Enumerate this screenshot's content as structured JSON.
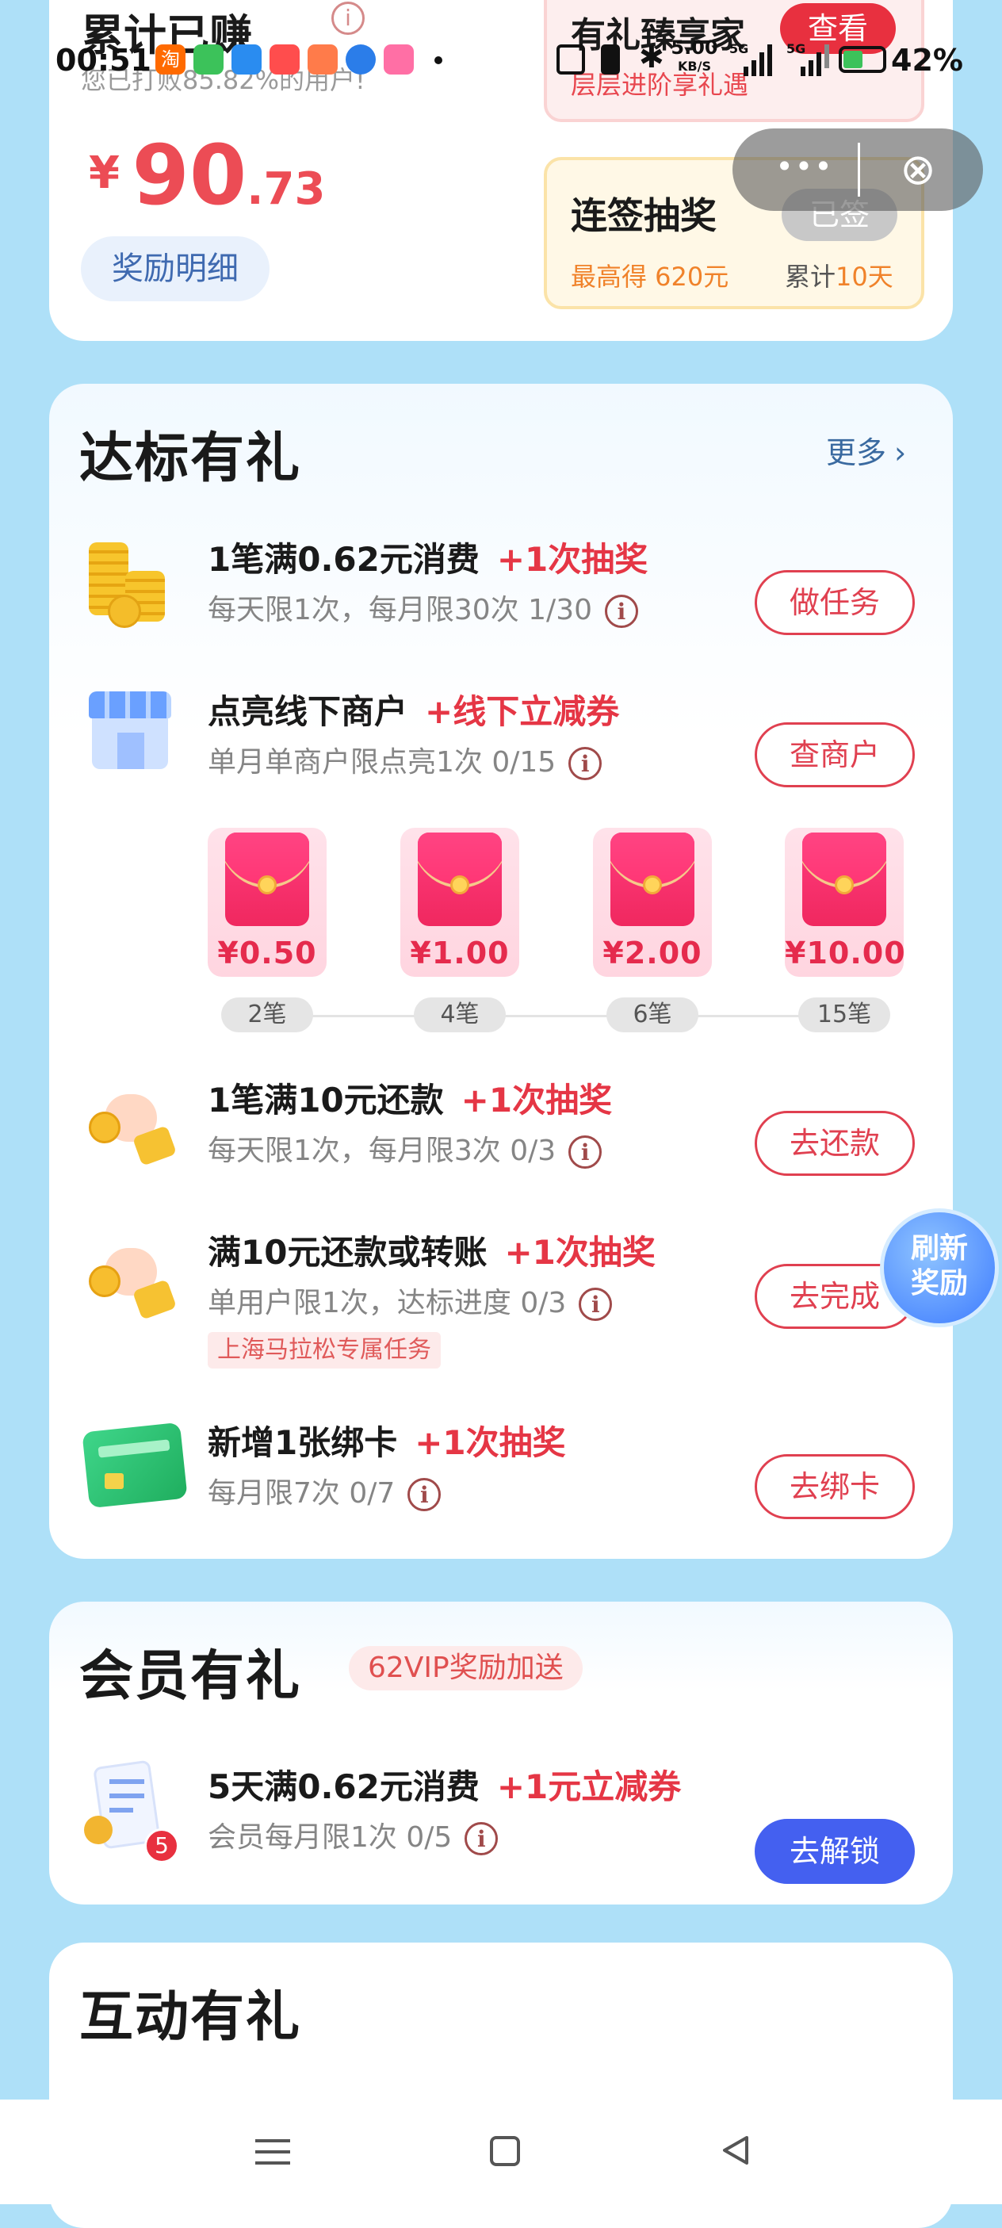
{
  "status_bar": {
    "time": "00:51",
    "app_icons": [
      "taobao-icon",
      "wechat-icon",
      "qq-icon",
      "app-icon",
      "mail-icon",
      "browser-icon",
      "bilibili-icon"
    ],
    "net_speed_top": "5.00",
    "net_speed_unit": "KB/S",
    "sig1": "5G",
    "sig2": "5G",
    "battery": "42%"
  },
  "earnings": {
    "title": "累计已赚",
    "subtitle": "您已打败85.82%的用户!",
    "currency": "¥",
    "amount_int": "90",
    "amount_dec": ".73",
    "detail_button": "奖励明细"
  },
  "vip_box": {
    "title": "有礼臻享家",
    "sub": "层层进阶享礼遇",
    "button": "查看"
  },
  "checkin_box": {
    "title": "连签抽奖",
    "status": "已签",
    "max_label": "最高得 620元",
    "streak_prefix": "累计",
    "streak_days": "10天"
  },
  "overlay": {
    "more": "•••",
    "close": "⊗"
  },
  "section_target": {
    "title": "达标有礼",
    "more": "更多",
    "tasks": [
      {
        "title": "1笔满0.62元消费",
        "reward": "+1次抽奖",
        "sub": "每天限1次，每月限30次 1/30",
        "button": "做任务"
      },
      {
        "title": "点亮线下商户",
        "reward": "+线下立减券",
        "sub": "单月单商户限点亮1次 0/15",
        "button": "查商户"
      },
      {
        "title": "1笔满10元还款",
        "reward": "+1次抽奖",
        "sub": "每天限1次，每月限3次 0/3",
        "button": "去还款"
      },
      {
        "title": "满10元还款或转账",
        "reward": "+1次抽奖",
        "sub": "单用户限1次，达标进度 0/3",
        "tag": "上海马拉松专属任务",
        "button": "去完成"
      },
      {
        "title": "新增1张绑卡",
        "reward": "+1次抽奖",
        "sub": "每月限7次 0/7",
        "button": "去绑卡"
      }
    ],
    "envelopes": [
      {
        "amount": "¥0.50",
        "count": "2笔"
      },
      {
        "amount": "¥1.00",
        "count": "4笔"
      },
      {
        "amount": "¥2.00",
        "count": "6笔"
      },
      {
        "amount": "¥10.00",
        "count": "15笔"
      }
    ]
  },
  "refresh_bubble": {
    "line1": "刷新",
    "line2": "奖励"
  },
  "section_member": {
    "title": "会员有礼",
    "badge": "62VIP奖励加送",
    "task": {
      "title": "5天满0.62元消费",
      "reward": "+1元立减券",
      "sub": "会员每月限1次 0/5",
      "button": "去解锁",
      "badge_num": "5"
    }
  },
  "section_interactive": {
    "title": "互动有礼"
  },
  "nav_bar": {
    "menu": "menu-icon",
    "home": "home-icon",
    "back": "back-icon"
  },
  "colors": {
    "accent_red": "#e53645",
    "blue_button": "#4460f0",
    "background": "#aee0f8"
  }
}
